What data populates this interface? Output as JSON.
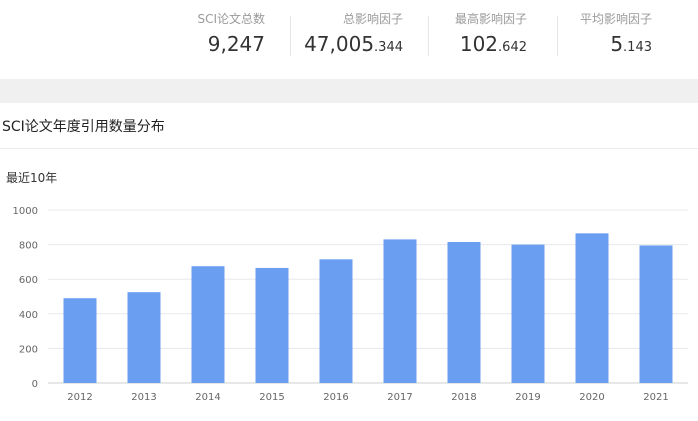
{
  "stats": [
    {
      "label": "SCI论文总数",
      "main": "9,247",
      "decimal": ""
    },
    {
      "label": "总影响因子",
      "main": "47,005",
      "decimal": ".344"
    },
    {
      "label": "最高影响因子",
      "main": "102",
      "decimal": ".642"
    },
    {
      "label": "平均影响因子",
      "main": "5",
      "decimal": ".143"
    }
  ],
  "section": {
    "title": "SCI论文年度引用数量分布",
    "subtitle": "最近10年"
  },
  "colors": {
    "bar": "#6a9ef1",
    "grid": "#e8e8e8",
    "axis_text": "#666666"
  },
  "chart_data": {
    "type": "bar",
    "categories": [
      "2012",
      "2013",
      "2014",
      "2015",
      "2016",
      "2017",
      "2018",
      "2019",
      "2020",
      "2021"
    ],
    "values": [
      490,
      525,
      675,
      665,
      715,
      830,
      815,
      800,
      865,
      795
    ],
    "ylim": [
      0,
      1000
    ],
    "yticks": [
      0,
      200,
      400,
      600,
      800,
      1000
    ],
    "grid": true,
    "title": "",
    "xlabel": "",
    "ylabel": ""
  }
}
